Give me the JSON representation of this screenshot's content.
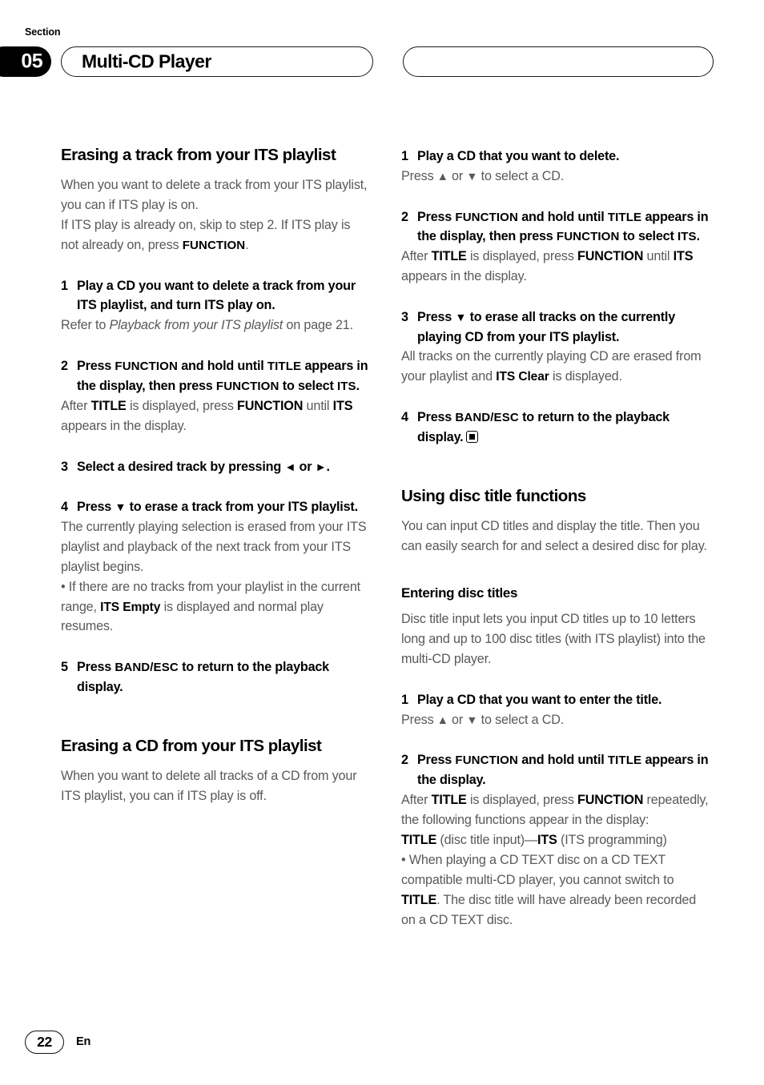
{
  "header": {
    "section_label": "Section",
    "section_number": "05",
    "chapter_title": "Multi-CD Player",
    "right_pill_title": ""
  },
  "left_column": {
    "heading_1": "Erasing a track from your ITS playlist",
    "intro_line_1": "When you want to delete a track from your ITS playlist, you can if ITS play is on.",
    "intro_line_2_a": "If ITS play is already on, skip to step 2. If ITS play is not already on, press ",
    "intro_line_2_b": "FUNCTION",
    "intro_line_2_c": ".",
    "step1_num": "1",
    "step1_text": "Play a CD you want to delete a track from your ITS playlist, and turn ITS play on.",
    "step1_body_a": "Refer to ",
    "step1_body_italic": "Playback from your ITS playlist",
    "step1_body_b": " on page 21.",
    "step2_num": "2",
    "step2_text_a": "Press ",
    "step2_key_function": "FUNCTION",
    "step2_text_b": " and hold until ",
    "step2_key_title": "TITLE",
    "step2_text_c": " appears in the display, then press ",
    "step2_key_function2": "FUNCTION",
    "step2_text_d": " to select ",
    "step2_key_its": "ITS",
    "step2_text_e": ".",
    "step2_body_a": "After ",
    "step2_body_title": "TITLE",
    "step2_body_b": " is displayed, press ",
    "step2_body_function": "FUNCTION",
    "step2_body_c": " until ",
    "step2_body_its": "ITS",
    "step2_body_d": " appears in the display.",
    "step3_num": "3",
    "step3_text_a": "Select a desired track by pressing ",
    "step3_arrow_left": "◄",
    "step3_text_b": " or ",
    "step3_arrow_right": "►",
    "step3_text_c": ".",
    "step4_num": "4",
    "step4_text_a": "Press ",
    "step4_arrow_down": "▼",
    "step4_text_b": " to erase a track from your ITS playlist.",
    "step4_body_1": "The currently playing selection is erased from your ITS playlist and playback of the next track from your ITS playlist begins.",
    "step4_body_2_a": "• If there are no tracks from your playlist in the current range, ",
    "step4_body_2_display": "ITS Empty",
    "step4_body_2_b": " is displayed and normal play resumes.",
    "step5_num": "5",
    "step5_text_a": "Press ",
    "step5_key_band": "BAND/ESC",
    "step5_text_b": " to return to the playback display.",
    "heading_2": "Erasing a CD from your ITS playlist",
    "heading_2_body": "When you want to delete all tracks of a CD from your ITS playlist, you can if ITS play is off."
  },
  "right_column": {
    "step1_num": "1",
    "step1_text": "Play a CD that you want to delete.",
    "step1_body_a": "Press ",
    "step1_arrow_up": "▲",
    "step1_body_b": " or ",
    "step1_arrow_down": "▼",
    "step1_body_c": " to select a CD.",
    "step2_num": "2",
    "step2_text_a": "Press ",
    "step2_key_function": "FUNCTION",
    "step2_text_b": " and hold until ",
    "step2_key_title": "TITLE",
    "step2_text_c": " appears in the display, then press ",
    "step2_key_function2": "FUNCTION",
    "step2_text_d": " to select ",
    "step2_key_its": "ITS",
    "step2_text_e": ".",
    "step2_body_a": "After ",
    "step2_body_title": "TITLE",
    "step2_body_b": " is displayed, press ",
    "step2_body_function": "FUNCTION",
    "step2_body_c": " until ",
    "step2_body_its": "ITS",
    "step2_body_d": " appears in the display.",
    "step3_num": "3",
    "step3_text_a": "Press ",
    "step3_arrow_down": "▼",
    "step3_text_b": " to erase all tracks on the currently playing CD from your ITS playlist.",
    "step3_body_a": "All tracks on the currently playing CD are erased from your playlist and ",
    "step3_body_display": "ITS Clear",
    "step3_body_b": " is displayed.",
    "step4_num": "4",
    "step4_text_a": "Press ",
    "step4_key_band": "BAND/ESC",
    "step4_text_b": " to return to the playback display.",
    "heading_main": "Using disc title functions",
    "heading_main_body": "You can input CD titles and display the title. Then you can easily search for and select a desired disc for play.",
    "heading_sub": "Entering disc titles",
    "heading_sub_body": "Disc title input lets you input CD titles up to 10 letters long and up to 100 disc titles (with ITS playlist) into the multi-CD player.",
    "s1_num": "1",
    "s1_text": "Play a CD that you want to enter the title.",
    "s1_body_a": "Press ",
    "s1_arrow_up": "▲",
    "s1_body_b": " or ",
    "s1_arrow_down": "▼",
    "s1_body_c": " to select a CD.",
    "s2_num": "2",
    "s2_text_a": "Press ",
    "s2_key_function": "FUNCTION",
    "s2_text_b": " and hold until ",
    "s2_key_title": "TITLE",
    "s2_text_c": " appears in the display.",
    "s2_body_a": "After ",
    "s2_body_title": "TITLE",
    "s2_body_b": " is displayed, press ",
    "s2_body_function": "FUNCTION",
    "s2_body_c": " repeatedly, the following functions appear in the display:",
    "s2_line_title": "TITLE",
    "s2_line_a": " (disc title input)—",
    "s2_line_its": "ITS",
    "s2_line_b": " (ITS programming)",
    "s2_bullet_a": "• When playing a CD TEXT disc on a CD TEXT compatible multi-CD player, you cannot switch to ",
    "s2_bullet_title": "TITLE",
    "s2_bullet_b": ". The disc title will have already been recorded on a CD TEXT disc."
  },
  "footer": {
    "page_number": "22",
    "language": "En"
  }
}
